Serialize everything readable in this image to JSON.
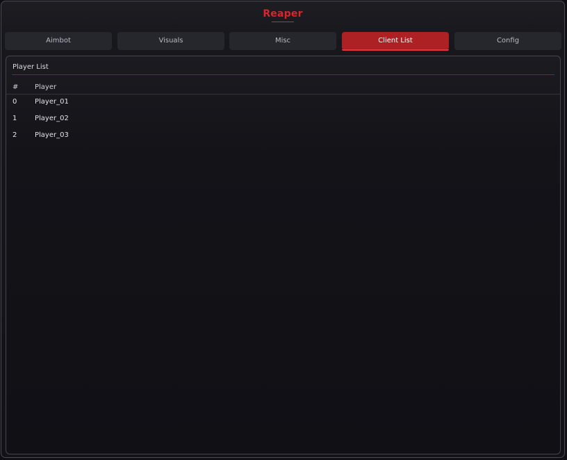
{
  "app": {
    "title": "Reaper"
  },
  "tabs": [
    {
      "label": "Aimbot",
      "active": false
    },
    {
      "label": "Visuals",
      "active": false
    },
    {
      "label": "Misc",
      "active": false
    },
    {
      "label": "Client List",
      "active": true
    },
    {
      "label": "Config",
      "active": false
    }
  ],
  "panel": {
    "title": "Player List",
    "columns": {
      "index": "#",
      "player": "Player"
    },
    "rows": [
      {
        "index": "0",
        "player": "Player_01"
      },
      {
        "index": "1",
        "player": "Player_02"
      },
      {
        "index": "2",
        "player": "Player_03"
      }
    ]
  },
  "colors": {
    "accent": "#d8262c",
    "active_tab": "#ad2125",
    "background": "#121217"
  }
}
